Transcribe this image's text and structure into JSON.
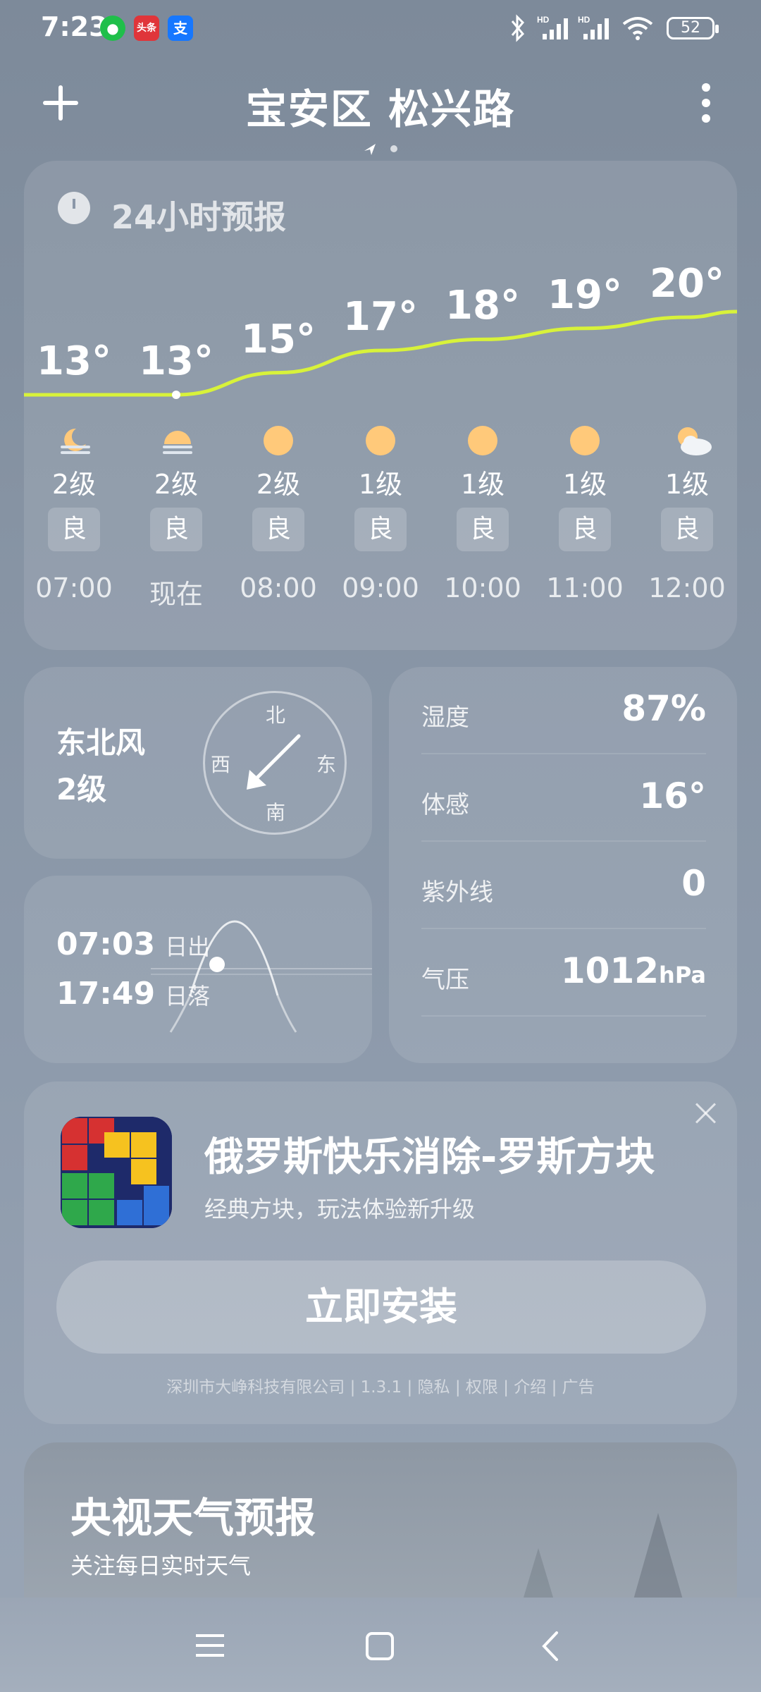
{
  "status_bar": {
    "time": "7:23",
    "battery": "52"
  },
  "header": {
    "location": "宝安区 松兴路"
  },
  "forecast": {
    "title": "24小时预报",
    "hours": [
      {
        "time": "07:00",
        "temp": "13°",
        "wind": "2级",
        "aqi": "良",
        "icon": "moon-haze-icon"
      },
      {
        "time": "现在",
        "temp": "13°",
        "wind": "2级",
        "aqi": "良",
        "icon": "sun-haze-icon"
      },
      {
        "time": "08:00",
        "temp": "15°",
        "wind": "2级",
        "aqi": "良",
        "icon": "sun-icon"
      },
      {
        "time": "09:00",
        "temp": "17°",
        "wind": "1级",
        "aqi": "良",
        "icon": "sun-icon"
      },
      {
        "time": "10:00",
        "temp": "18°",
        "wind": "1级",
        "aqi": "良",
        "icon": "sun-icon"
      },
      {
        "time": "11:00",
        "temp": "19°",
        "wind": "1级",
        "aqi": "良",
        "icon": "sun-icon"
      },
      {
        "time": "12:00",
        "temp": "20°",
        "wind": "1级",
        "aqi": "良",
        "icon": "partly-cloudy-icon"
      }
    ],
    "temps": [
      13,
      13,
      15,
      17,
      18,
      19,
      20
    ]
  },
  "wind": {
    "direction": "东北风",
    "level": "2级",
    "compass": {
      "n": "北",
      "s": "南",
      "e": "东",
      "w": "西"
    }
  },
  "sun": {
    "sunrise": "07:03",
    "sunrise_label": "日出",
    "sunset": "17:49",
    "sunset_label": "日落"
  },
  "details": {
    "humidity_label": "湿度",
    "humidity": "87%",
    "feels_label": "体感",
    "feels": "16°",
    "uv_label": "紫外线",
    "uv": "0",
    "pressure_label": "气压",
    "pressure": "1012",
    "pressure_unit": "hPa"
  },
  "ad": {
    "title": "俄罗斯快乐消除-罗斯方块",
    "subtitle": "经典方块，玩法体验新升级",
    "install": "立即安装",
    "footer": "深圳市大峥科技有限公司 | 1.3.1 | 隐私 | 权限 | 介绍 | 广告"
  },
  "cctv": {
    "title": "央视天气预报",
    "subtitle": "关注每日实时天气"
  },
  "colors": {
    "temp_line": "#d8f23a",
    "sun_icon": "#ffc97a"
  }
}
